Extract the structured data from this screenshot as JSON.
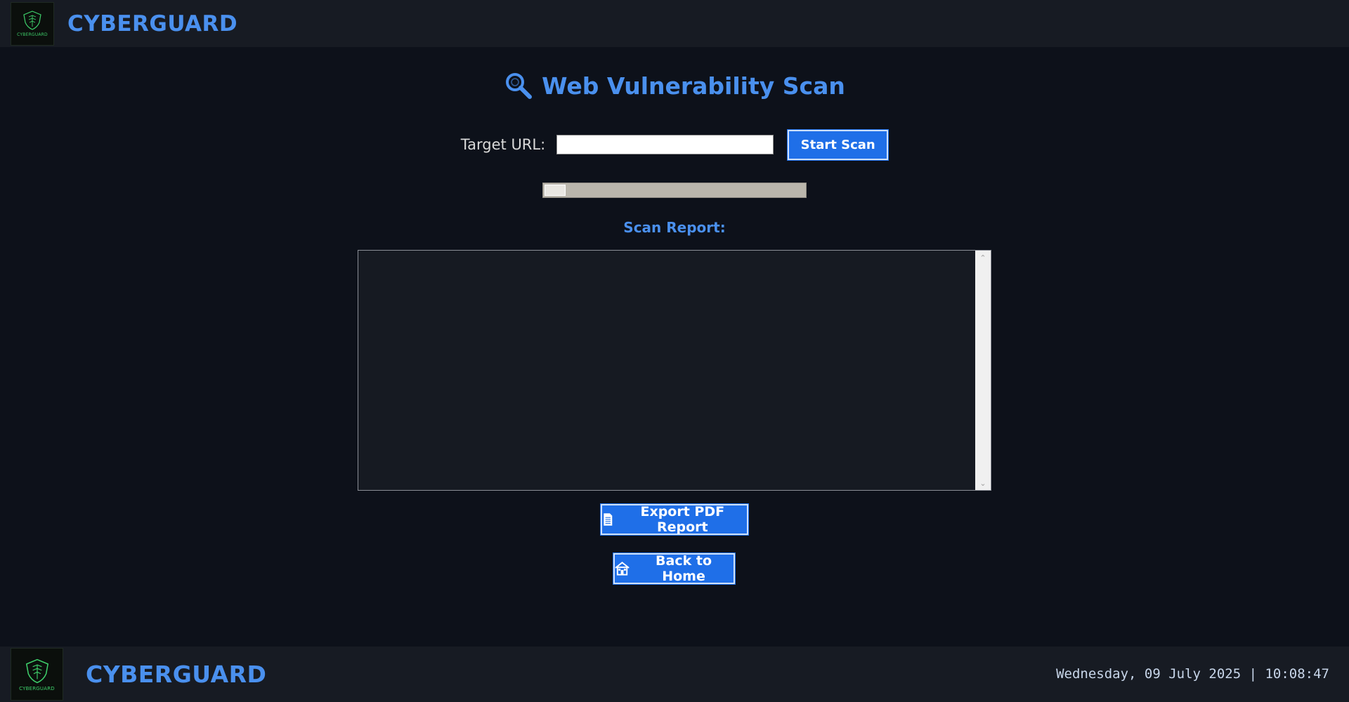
{
  "header": {
    "logo_text": "CYBERGUARD",
    "brand": "CYBERGUARD"
  },
  "main": {
    "title": "Web Vulnerability Scan",
    "url_label": "Target URL:",
    "url_value": "",
    "start_scan_label": "Start Scan",
    "progress_percent": 8,
    "report_label": "Scan Report:",
    "report_text": "",
    "export_label": "Export PDF Report",
    "home_label": "Back to Home"
  },
  "footer": {
    "logo_text": "CYBERGUARD",
    "brand": "CYBERGUARD",
    "datetime": "Wednesday, 09 July 2025 | 10:08:47"
  },
  "colors": {
    "accent": "#4a90ee",
    "button": "#1f6fe8",
    "background": "#0d111a",
    "bar": "#171b23",
    "logo_green": "#3ecf6a"
  },
  "icons": {
    "title": "magnifier-icon",
    "export": "document-icon",
    "home": "home-icon",
    "logo": "shield-icon"
  }
}
